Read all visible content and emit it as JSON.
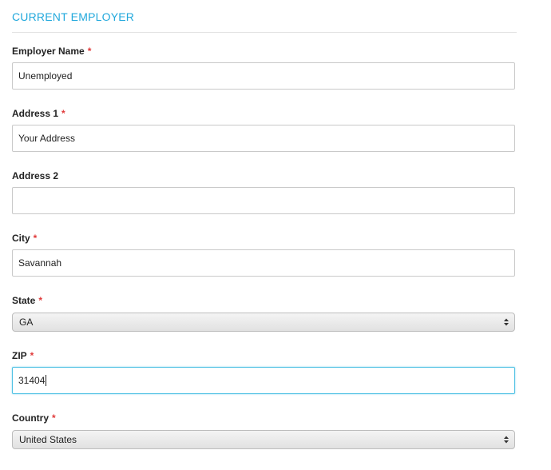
{
  "section": {
    "title": "CURRENT EMPLOYER"
  },
  "required_mark": "*",
  "fields": {
    "employer_name": {
      "label": "Employer Name",
      "value": "Unemployed",
      "required": true
    },
    "address1": {
      "label": "Address 1",
      "value": "Your Address",
      "required": true
    },
    "address2": {
      "label": "Address 2",
      "value": "",
      "required": false
    },
    "city": {
      "label": "City",
      "value": "Savannah",
      "required": true
    },
    "state": {
      "label": "State",
      "value": "GA",
      "required": true
    },
    "zip": {
      "label": "ZIP",
      "value": "31404",
      "required": true
    },
    "country": {
      "label": "Country",
      "value": "United States",
      "required": true
    }
  },
  "icons": {
    "select_arrows": "up-down-chevron-icon"
  },
  "colors": {
    "section_title": "#21a8dc",
    "required": "#e03a3a",
    "focus_border": "#4fc1e4"
  }
}
